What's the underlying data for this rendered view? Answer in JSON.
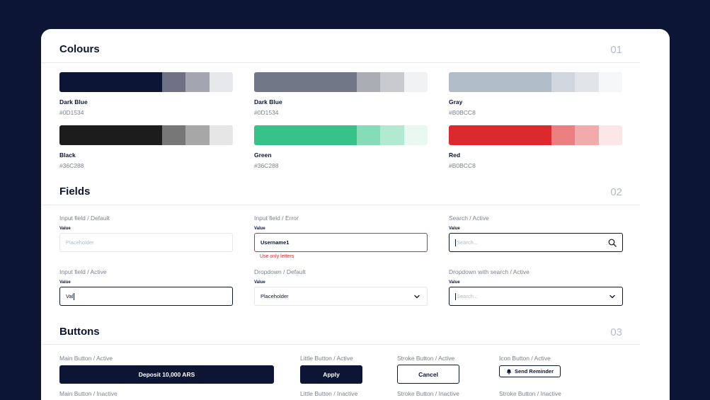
{
  "colours": {
    "title": "Colours",
    "number": "01",
    "swatches": [
      {
        "name": "Dark Blue",
        "hex": "#0D1534",
        "shades": [
          "#0D1534",
          "#6E7184",
          "#A3A5B0",
          "#E6E7EA"
        ]
      },
      {
        "name": "Dark Blue",
        "hex": "#0D1534",
        "shades": [
          "#717786",
          "#ABADB4",
          "#C8CACF",
          "#F1F2F4"
        ]
      },
      {
        "name": "Gray",
        "hex": "#B0BCC8",
        "shades": [
          "#B0BCC8",
          "#D0D6DE",
          "#E1E5EA",
          "#F6F7F9"
        ]
      },
      {
        "name": "Black",
        "hex": "#36C288",
        "shades": [
          "#1C1C1C",
          "#777777",
          "#A7A7A7",
          "#E6E6E6"
        ]
      },
      {
        "name": "Green",
        "hex": "#36C288",
        "shades": [
          "#36C288",
          "#86DCB8",
          "#B1E9D1",
          "#EAF8F2"
        ]
      },
      {
        "name": "Red",
        "hex": "#B0BCC8",
        "shades": [
          "#DC2A2C",
          "#EB7F80",
          "#F1ABAB",
          "#FBE7E7"
        ]
      }
    ]
  },
  "fields": {
    "title": "Fields",
    "number": "02",
    "default": {
      "caption": "Input field / Default",
      "label": "Value",
      "placeholder": "Placeholder"
    },
    "error": {
      "caption": "Input field / Error",
      "label": "Value",
      "value": "Username1",
      "error": "Use only letters"
    },
    "search": {
      "caption": "Search / Active",
      "label": "Value",
      "placeholder": "Search..."
    },
    "active": {
      "caption": "Input field / Active",
      "label": "Value",
      "value": "Val"
    },
    "dropdown": {
      "caption": "Dropdown / Default",
      "label": "Value",
      "value": "Placeholder"
    },
    "dropdown_search": {
      "caption": "Dropdown with search / Active",
      "label": "Value",
      "placeholder": "Search..."
    }
  },
  "buttons": {
    "title": "Buttons",
    "number": "03",
    "main_active": {
      "caption": "Main Button / Active",
      "label": "Deposit 10,000 ARS"
    },
    "little_active": {
      "caption": "Little Button / Active",
      "label": "Apply"
    },
    "stroke_active": {
      "caption": "Stroke Button / Active",
      "label": "Cancel"
    },
    "icon_active": {
      "caption": "Icon Button / Active",
      "label": "Send Reminder",
      "icon": "bell-icon"
    },
    "main_inactive": {
      "caption": "Main Button / Inactive"
    },
    "little_inactive": {
      "caption": "Little Button / Inactive"
    },
    "stroke_inactive": {
      "caption": "Stroke Button / Inactive"
    },
    "stroke_inactive_2": {
      "caption": "Stroke Button / Inactive"
    }
  },
  "colors": {
    "background": "#0D1534",
    "card": "#FFFFFF",
    "error": "#DC2A2C",
    "muted": "#B0BCC8"
  }
}
